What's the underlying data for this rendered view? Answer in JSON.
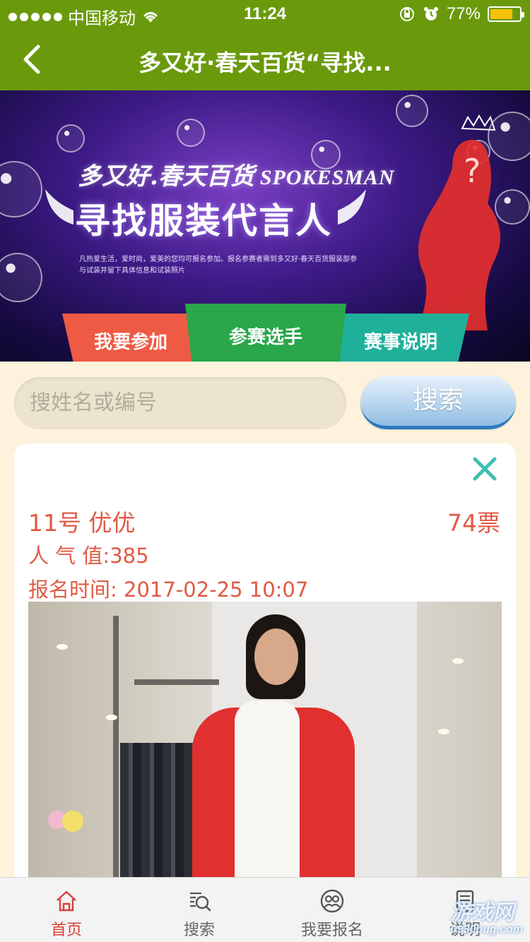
{
  "status_bar": {
    "carrier": "中国移动",
    "time": "11:24",
    "battery_percent": "77%",
    "battery_level": 0.77,
    "wifi_icon": "wifi-icon",
    "lock_icon": "rotation-lock-icon",
    "alarm_icon": "alarm-icon"
  },
  "nav": {
    "title": "多又好·春天百货“寻找...",
    "back_icon": "chevron-left-icon"
  },
  "banner": {
    "line1": "多又好.春天百货",
    "brand_en": "SPOKESMAN",
    "line2": "寻找服装代言人",
    "small_text": "凡热爱生活，爱时尚，爱美的您均可报名参加。报名参赛者需到多又好·春天百货服装部参与试装并留下具体信息和试装照片"
  },
  "tabs": [
    {
      "label": "我要参加",
      "color": "#ef5a45"
    },
    {
      "label": "参赛选手",
      "color": "#2aa74a"
    },
    {
      "label": "赛事说明",
      "color": "#1fb09a"
    }
  ],
  "search": {
    "placeholder": "搜姓名或编号",
    "button_label": "搜索"
  },
  "card": {
    "entry": "11号 优优",
    "votes": "74票",
    "popularity": "人 气 值:385",
    "signup_time": "报名时间: 2017-02-25 10:07",
    "close_icon": "close-icon",
    "accent_color": "#e05a45"
  },
  "bottom_tabs": [
    {
      "label": "首页",
      "icon": "home-icon",
      "active": true
    },
    {
      "label": "搜索",
      "icon": "search-icon",
      "active": false
    },
    {
      "label": "我要报名",
      "icon": "signup-icon",
      "active": false
    },
    {
      "label": "说明",
      "icon": "document-icon",
      "active": false
    }
  ],
  "watermark": {
    "text": "游戏网",
    "sub": "0930bug.com"
  }
}
